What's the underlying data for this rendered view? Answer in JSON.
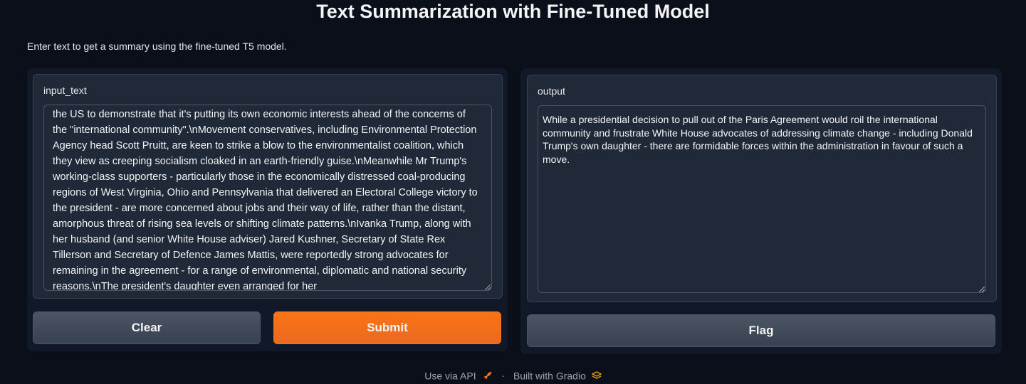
{
  "title": "Text Summarization with Fine-Tuned Model",
  "description": "Enter text to get a summary using the fine-tuned T5 model.",
  "input": {
    "label": "input_text",
    "value": "the US to demonstrate that it's putting its own economic interests ahead of the concerns of the \"international community\".\\nMovement conservatives, including Environmental Protection Agency head Scott Pruitt, are keen to strike a blow to the environmentalist coalition, which they view as creeping socialism cloaked in an earth-friendly guise.\\nMeanwhile Mr Trump's working-class supporters - particularly those in the economically distressed coal-producing regions of West Virginia, Ohio and Pennsylvania that delivered an Electoral College victory to the president - are more concerned about jobs and their way of life, rather than the distant, amorphous threat of rising sea levels or shifting climate patterns.\\nIvanka Trump, along with her husband (and senior White House adviser) Jared Kushner, Secretary of State Rex Tillerson and Secretary of Defence James Mattis, were reportedly strong advocates for remaining in the agreement - for a range of environmental, diplomatic and national security reasons.\\nThe president's daughter even arranged for her"
  },
  "output": {
    "label": "output",
    "value": "While a presidential decision to pull out of the Paris Agreement would roil the international community and frustrate White House advocates of addressing climate change - including Donald Trump's own daughter - there are formidable forces within the administration in favour of such a move."
  },
  "buttons": {
    "clear": "Clear",
    "submit": "Submit",
    "flag": "Flag"
  },
  "footer": {
    "api": "Use via API",
    "separator": "·",
    "built": "Built with Gradio"
  },
  "colors": {
    "background": "#0b0f19",
    "accent": "#f97316",
    "panel": "#1f2937"
  }
}
